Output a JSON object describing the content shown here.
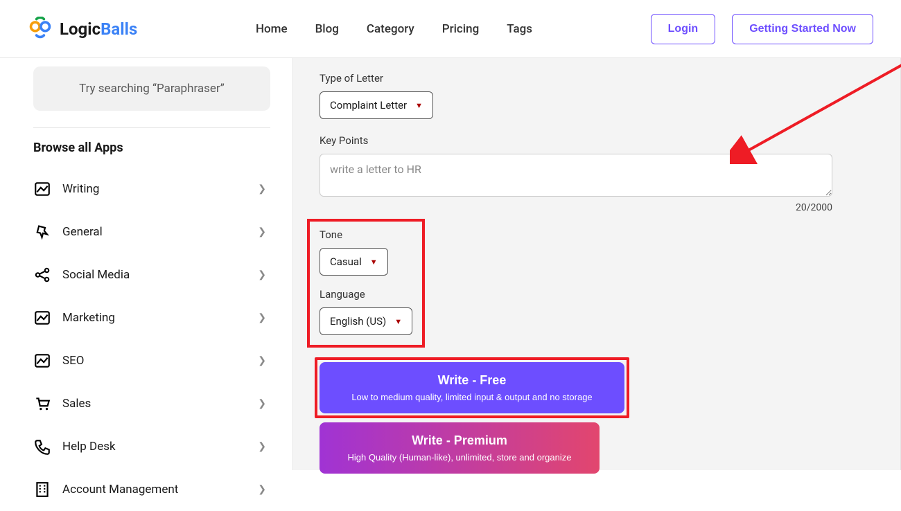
{
  "header": {
    "logo_part1": "Logic",
    "logo_part2": "Balls",
    "nav": [
      "Home",
      "Blog",
      "Category",
      "Pricing",
      "Tags"
    ],
    "login": "Login",
    "cta": "Getting Started Now"
  },
  "sidebar": {
    "search_placeholder": "Try searching “Paraphraser”",
    "browse_title": "Browse all Apps",
    "categories": [
      "Writing",
      "General",
      "Social Media",
      "Marketing",
      "SEO",
      "Sales",
      "Help Desk",
      "Account Management"
    ]
  },
  "form": {
    "type_label": "Type of Letter",
    "type_value": "Complaint Letter",
    "keypoints_label": "Key Points",
    "keypoints_value": "write a letter to HR",
    "char_count": "20/2000",
    "tone_label": "Tone",
    "tone_value": "Casual",
    "language_label": "Language",
    "language_value": "English (US)",
    "free": {
      "title": "Write - Free",
      "sub": "Low to medium quality, limited input & output and no storage"
    },
    "premium": {
      "title": "Write - Premium",
      "sub": "High Quality (Human-like), unlimited, store and organize"
    }
  },
  "colors": {
    "accent": "#6d4eff",
    "highlight": "#ee1c25"
  }
}
